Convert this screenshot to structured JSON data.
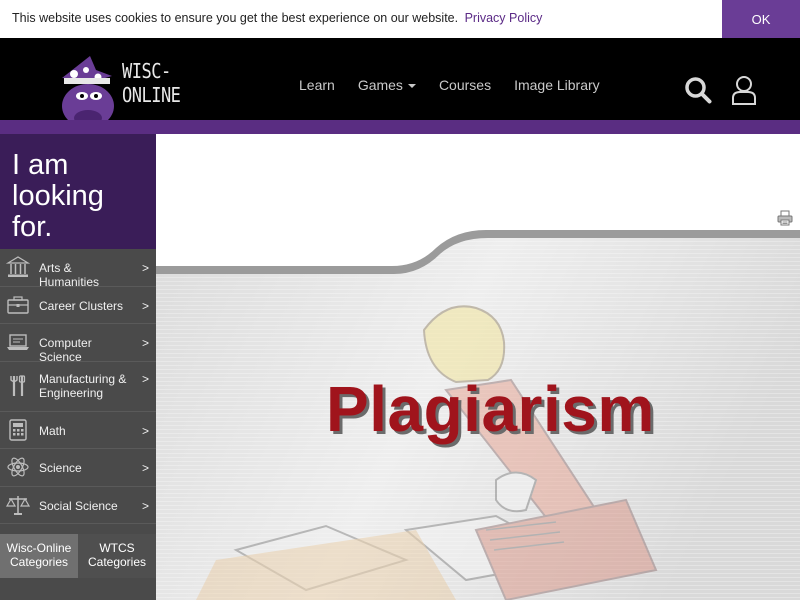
{
  "cookie": {
    "message": "This website uses cookies to ensure you get the best experience on our website.",
    "link_label": "Privacy Policy",
    "ok_label": "OK"
  },
  "header": {
    "logo_text": "WISC-ONLINE",
    "nav": [
      {
        "label": "Learn"
      },
      {
        "label": "Games"
      },
      {
        "label": "Courses"
      },
      {
        "label": "Image Library"
      }
    ]
  },
  "sidebar": {
    "title": "I am looking for.",
    "categories": [
      {
        "label": "Arts & Humanities",
        "icon": "museum-icon",
        "arrow": ">"
      },
      {
        "label": "Career Clusters",
        "icon": "briefcase-icon",
        "arrow": ">"
      },
      {
        "label": "Computer Science",
        "icon": "laptop-icon",
        "arrow": ">"
      },
      {
        "label": "Manufacturing & Engineering",
        "icon": "tools-icon",
        "arrow": ">"
      },
      {
        "label": "Math",
        "icon": "calculator-icon",
        "arrow": ">"
      },
      {
        "label": "Science",
        "icon": "atom-icon",
        "arrow": ">"
      },
      {
        "label": "Social Science",
        "icon": "scales-icon",
        "arrow": ">"
      }
    ],
    "tabs": [
      {
        "label": "Wisc-Online Categories"
      },
      {
        "label": "WTCS Categories"
      }
    ]
  },
  "main": {
    "banner_title": "Plagiarism"
  },
  "colors": {
    "accent_purple": "#5a2d82",
    "cookie_ok": "#6a3d96",
    "banner_title": "#a0141c"
  }
}
